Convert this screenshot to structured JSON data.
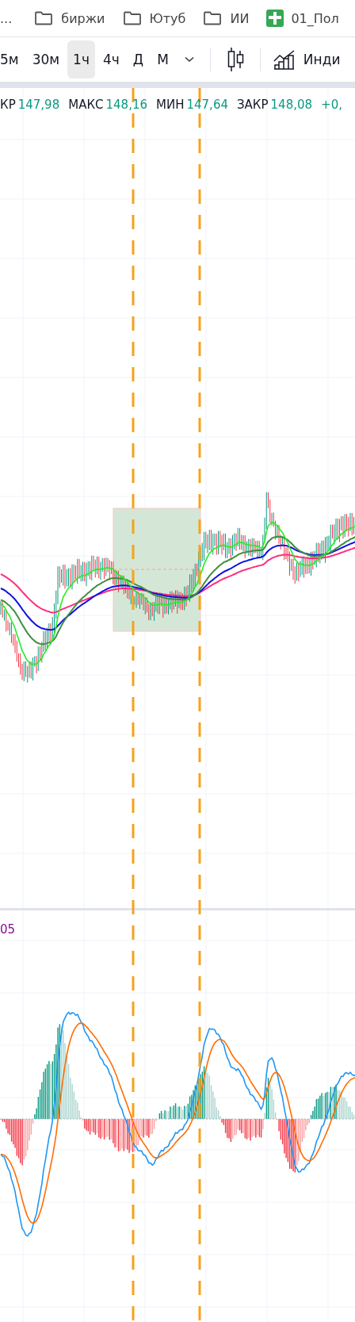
{
  "bookmarks": [
    {
      "kind": "more",
      "label": "..."
    },
    {
      "kind": "folder",
      "label": "биржи"
    },
    {
      "kind": "folder",
      "label": "Ютуб"
    },
    {
      "kind": "folder",
      "label": "ИИ"
    },
    {
      "kind": "sheet",
      "label": "01_Пол"
    }
  ],
  "toolbar": {
    "intervals": [
      {
        "label": "5м",
        "selected": false
      },
      {
        "label": "30м",
        "selected": false
      },
      {
        "label": "1ч",
        "selected": true
      },
      {
        "label": "4ч",
        "selected": false
      },
      {
        "label": "Д",
        "selected": false
      },
      {
        "label": "М",
        "selected": false
      }
    ],
    "indicators_label": "Инди"
  },
  "legend": [
    {
      "kind": "pair",
      "label": "КР",
      "value": "147,98"
    },
    {
      "kind": "pair",
      "label": "МАКС",
      "value": "148,16"
    },
    {
      "kind": "pair",
      "label": "МИН",
      "value": "147,64"
    },
    {
      "kind": "pair",
      "label": "ЗАКР",
      "value": "148,08"
    },
    {
      "kind": "change",
      "value": "+0,"
    }
  ],
  "macd_pane": {
    "legend_value": "05"
  }
}
